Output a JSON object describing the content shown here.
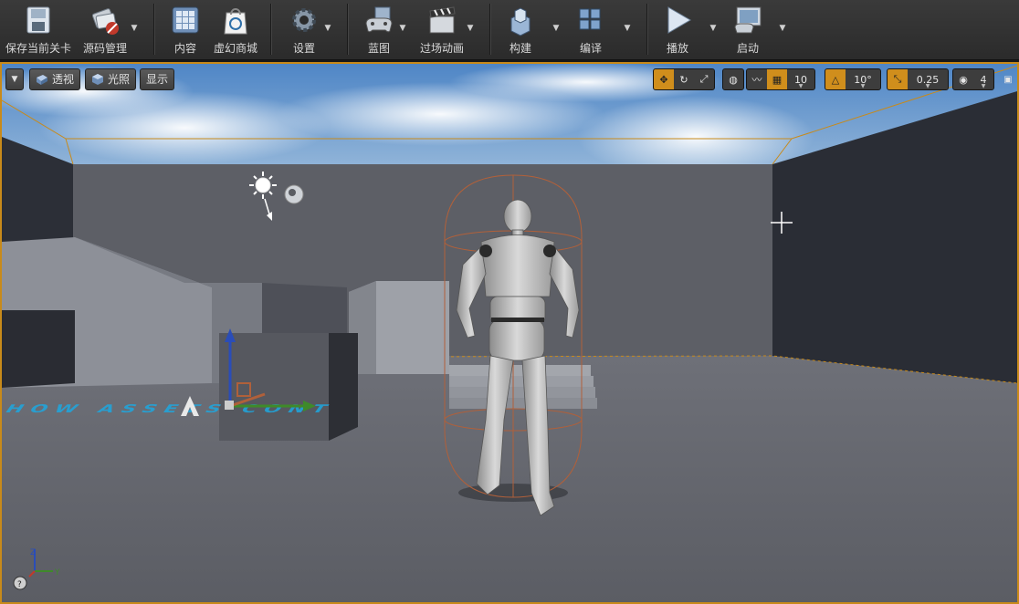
{
  "toolbar": {
    "buttons": [
      {
        "label": "保存当前关卡",
        "icon": "save-icon"
      },
      {
        "label": "源码管理",
        "icon": "source-control-icon"
      },
      {
        "label": "内容",
        "icon": "content-browser-icon"
      },
      {
        "label": "虚幻商城",
        "icon": "marketplace-icon"
      },
      {
        "label": "设置",
        "icon": "settings-gear-icon"
      },
      {
        "label": "蓝图",
        "icon": "blueprint-gamepad-icon"
      },
      {
        "label": "过场动画",
        "icon": "cinematics-clapper-icon"
      },
      {
        "label": "构建",
        "icon": "build-blocks-icon"
      },
      {
        "label": "编译",
        "icon": "compile-cubes-icon"
      },
      {
        "label": "播放",
        "icon": "play-icon"
      },
      {
        "label": "启动",
        "icon": "launch-monitor-icon"
      }
    ]
  },
  "viewport": {
    "menu_icon": "chevron-down-icon",
    "perspective_label": "透视",
    "lit_label": "光照",
    "show_label": "显示",
    "grid_snap_value": "10",
    "rotation_snap_value": "10°",
    "scale_snap_value": "0.25",
    "camera_speed_value": "4",
    "axis_labels": {
      "z": "Z",
      "y": "Y"
    },
    "floor_text": "HOW ASSETS CONT"
  },
  "colors": {
    "accent_orange": "#d08e1c",
    "viewport_border": "#c88a1a",
    "floor_text": "#1ea7e0"
  }
}
